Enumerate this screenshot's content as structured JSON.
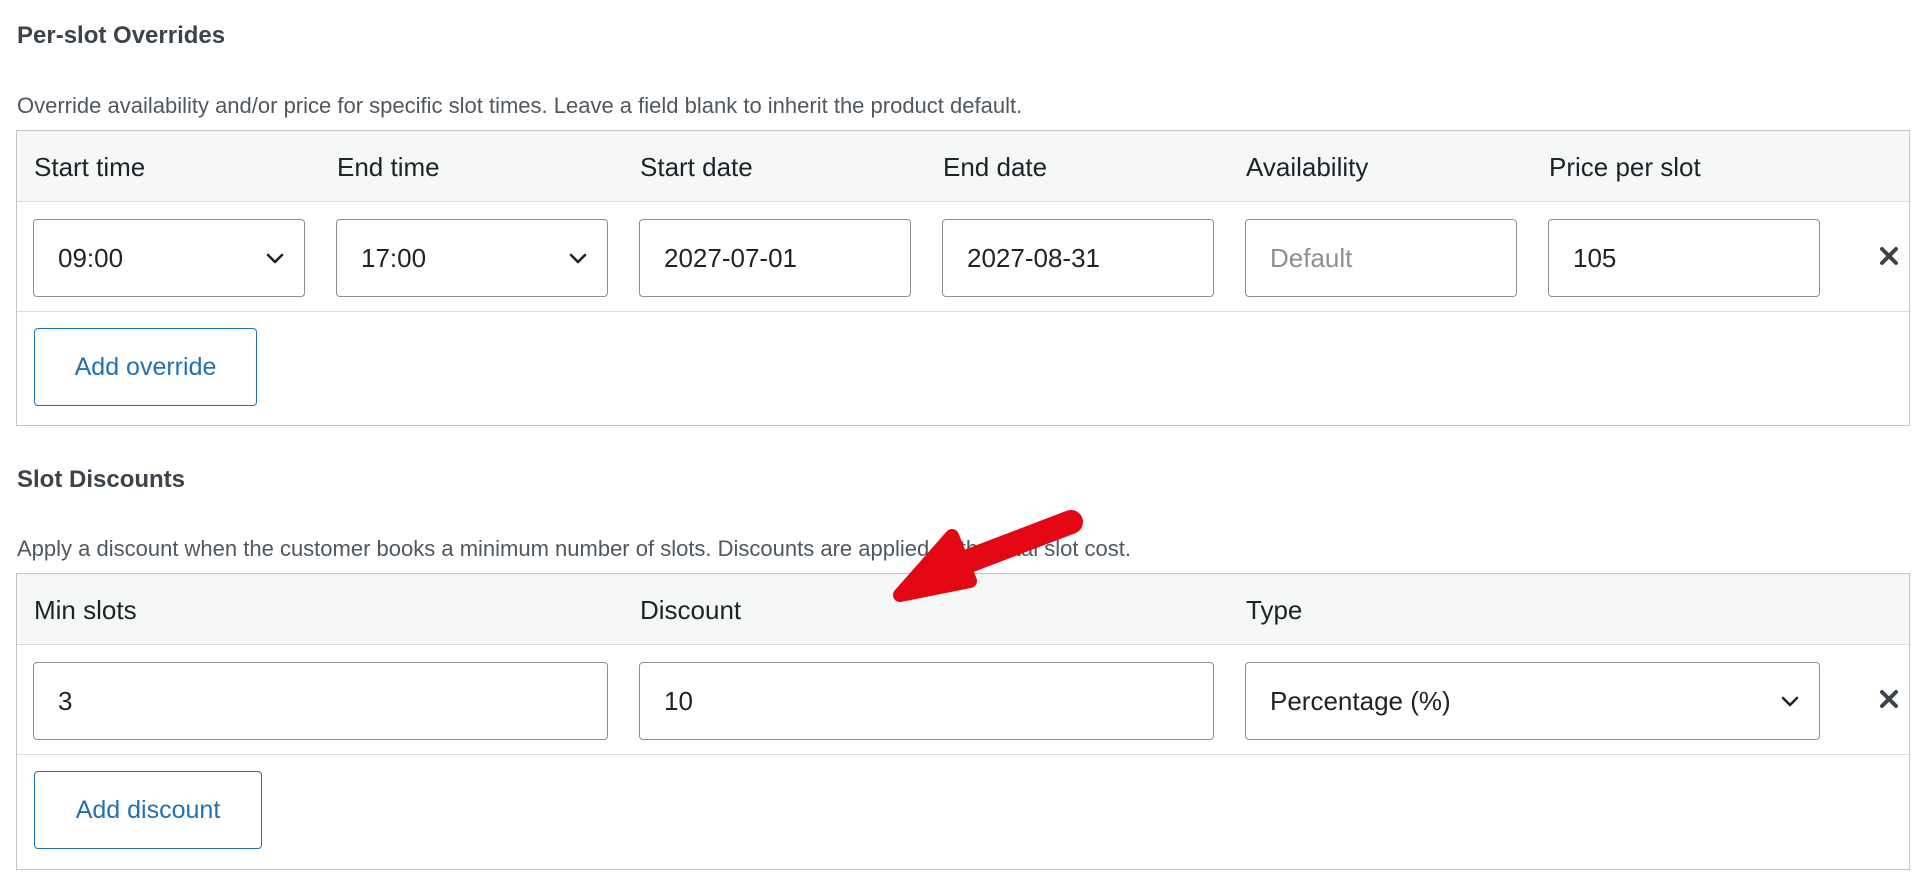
{
  "overrides": {
    "title": "Per-slot Overrides",
    "description": "Override availability and/or price for specific slot times. Leave a field blank to inherit the product default.",
    "columns": [
      "Start time",
      "End time",
      "Start date",
      "End date",
      "Availability",
      "Price per slot"
    ],
    "row": {
      "start_time": "09:00",
      "end_time": "17:00",
      "start_date": "2027-07-01",
      "end_date": "2027-08-31",
      "availability_placeholder": "Default",
      "availability": "",
      "price": "105"
    },
    "add_label": "Add override"
  },
  "discounts": {
    "title": "Slot Discounts",
    "description": "Apply a discount when the customer books a minimum number of slots. Discounts are applied to the total slot cost.",
    "columns": [
      "Min slots",
      "Discount",
      "Type"
    ],
    "row": {
      "min_slots": "3",
      "discount": "10",
      "type": "Percentage (%)"
    },
    "add_label": "Add discount"
  },
  "icons": {
    "remove": "close-icon",
    "dropdown": "chevron-down-icon",
    "annotation": "red-arrow-annotation"
  },
  "colors": {
    "accent": "#2271b1",
    "annotation": "#e30613",
    "border": "#c3c4c7",
    "header_bg": "#f6f7f7"
  }
}
